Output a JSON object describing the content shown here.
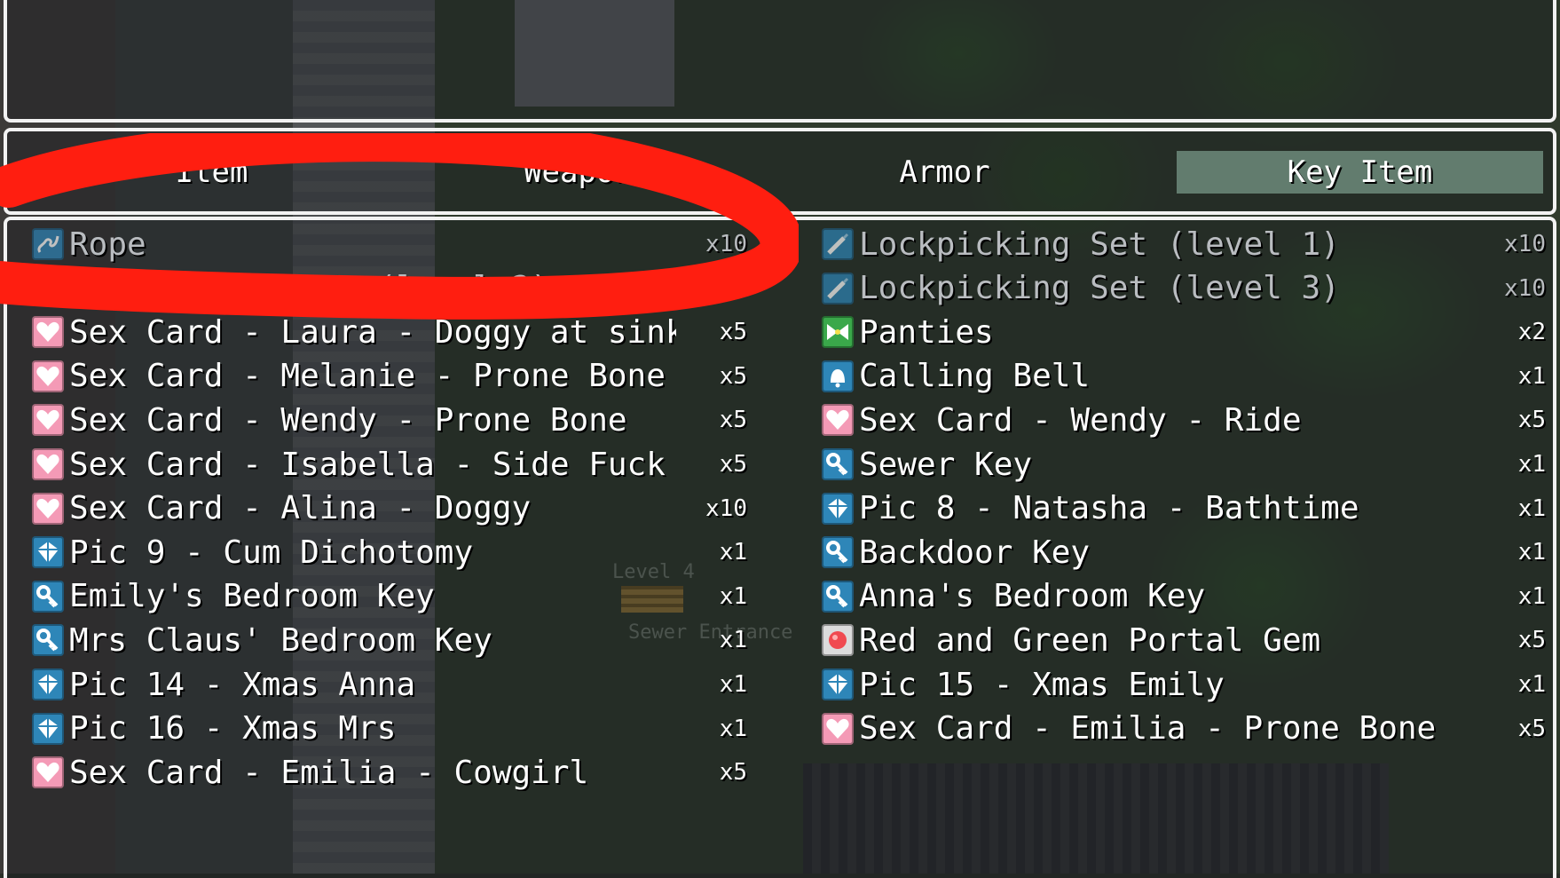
{
  "tabs": [
    {
      "label": "Item",
      "selected": false
    },
    {
      "label": "Weapon",
      "selected": false
    },
    {
      "label": "Armor",
      "selected": false
    },
    {
      "label": "Key Item",
      "selected": true
    }
  ],
  "map_labels": {
    "level": "Level 4",
    "sewer": "Sewer Entrance"
  },
  "items_left": [
    {
      "icon": "rope-icon",
      "name": "Rope",
      "qty": "x10",
      "dim": true
    },
    {
      "icon": "lockpick-icon",
      "name": "Lockpicking Set (level 2)",
      "qty": "",
      "dim": true
    },
    {
      "icon": "heart-icon",
      "name": "Sex Card - Laura - Doggy at sink(Day)",
      "qty": "x5"
    },
    {
      "icon": "heart-icon",
      "name": "Sex Card - Melanie - Prone Bone",
      "qty": "x5"
    },
    {
      "icon": "heart-icon",
      "name": "Sex Card - Wendy - Prone Bone",
      "qty": "x5"
    },
    {
      "icon": "heart-icon",
      "name": "Sex Card - Isabella - Side Fuck",
      "qty": "x5"
    },
    {
      "icon": "heart-icon",
      "name": "Sex Card - Alina - Doggy",
      "qty": "x10"
    },
    {
      "icon": "picture-icon",
      "name": "Pic 9 - Cum Dichotomy",
      "qty": "x1"
    },
    {
      "icon": "key-icon",
      "name": "Emily's Bedroom Key",
      "qty": "x1"
    },
    {
      "icon": "key-icon",
      "name": "Mrs Claus' Bedroom Key",
      "qty": "x1"
    },
    {
      "icon": "picture-icon",
      "name": "Pic 14 - Xmas Anna",
      "qty": "x1"
    },
    {
      "icon": "picture-icon",
      "name": "Pic 16 - Xmas Mrs",
      "qty": "x1"
    },
    {
      "icon": "heart-icon",
      "name": "Sex Card - Emilia - Cowgirl",
      "qty": "x5"
    }
  ],
  "items_right": [
    {
      "icon": "lockpick-icon",
      "name": "Lockpicking Set (level 1)",
      "qty": "x10",
      "dim": true
    },
    {
      "icon": "lockpick-icon",
      "name": "Lockpicking Set (level 3)",
      "qty": "x10",
      "dim": true
    },
    {
      "icon": "bow-icon",
      "name": "Panties",
      "qty": "x2"
    },
    {
      "icon": "bell-icon",
      "name": "Calling Bell",
      "qty": "x1"
    },
    {
      "icon": "heart-icon",
      "name": "Sex Card - Wendy - Ride",
      "qty": "x5"
    },
    {
      "icon": "key-icon",
      "name": "Sewer Key",
      "qty": "x1"
    },
    {
      "icon": "picture-icon",
      "name": "Pic 8 - Natasha - Bathtime",
      "qty": "x1"
    },
    {
      "icon": "key-icon",
      "name": "Backdoor Key",
      "qty": "x1"
    },
    {
      "icon": "key-icon",
      "name": "Anna's Bedroom Key",
      "qty": "x1"
    },
    {
      "icon": "gem-icon",
      "name": "Red and Green Portal Gem",
      "qty": "x5"
    },
    {
      "icon": "picture-icon",
      "name": "Pic 15 - Xmas Emily",
      "qty": "x1"
    },
    {
      "icon": "heart-icon",
      "name": "Sex Card - Emilia - Prone Bone",
      "qty": "x5"
    }
  ],
  "colors": {
    "annotation": "#ff1e10",
    "tab_highlight": "#8fb8a6",
    "window_border": "#f2f2f2"
  }
}
